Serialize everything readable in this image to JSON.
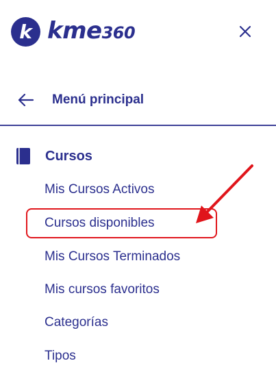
{
  "brand": {
    "mark_letter": "k",
    "name_text": "kme",
    "name_number": "360",
    "color": "#2b2f8e"
  },
  "header": {
    "close_icon": "close-icon"
  },
  "nav": {
    "back_label": "Menú principal",
    "back_icon": "arrow-left-icon"
  },
  "section": {
    "title": "Cursos",
    "icon": "book-icon",
    "items": [
      {
        "label": "Mis Cursos Activos"
      },
      {
        "label": "Cursos disponibles",
        "highlighted": true
      },
      {
        "label": "Mis Cursos Terminados"
      },
      {
        "label": "Mis cursos favoritos"
      },
      {
        "label": "Categorías"
      },
      {
        "label": "Tipos"
      }
    ]
  },
  "annotation": {
    "color": "#e0151b",
    "target": "Cursos disponibles"
  }
}
